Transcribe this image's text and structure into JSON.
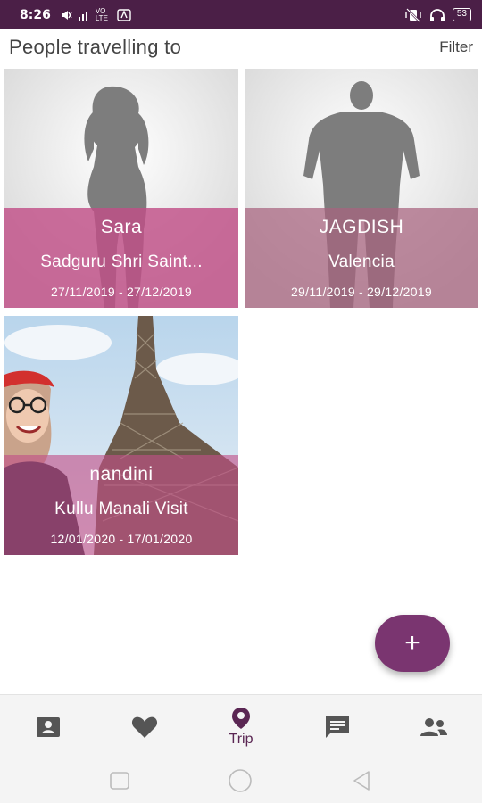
{
  "status_bar": {
    "time": "8:26",
    "network_label": "VO LTE",
    "battery": "53"
  },
  "header": {
    "title": "People travelling to",
    "filter_label": "Filter"
  },
  "cards": [
    {
      "name": "Sara",
      "place": "Sadguru Shri Saint...",
      "start_date": "27/11/2019",
      "end_date": "27/12/2019",
      "photo_icon": "female-silhouette"
    },
    {
      "name": "JAGDISH",
      "place": "Valencia",
      "start_date": "29/11/2019",
      "end_date": "29/12/2019",
      "photo_icon": "male-silhouette"
    },
    {
      "name": "nandini",
      "place": "Kullu Manali Visit",
      "start_date": "12/01/2020",
      "end_date": "17/01/2020",
      "photo_icon": "eiffel-tower-photo"
    }
  ],
  "date_separator": "-",
  "fab": {
    "label": "+"
  },
  "bottom_nav": {
    "items": [
      {
        "icon": "contact-card-icon",
        "label": ""
      },
      {
        "icon": "heart-icon",
        "label": ""
      },
      {
        "icon": "location-pin-icon",
        "label": "Trip"
      },
      {
        "icon": "chat-icon",
        "label": ""
      },
      {
        "icon": "people-icon",
        "label": ""
      }
    ]
  },
  "colors": {
    "status_bar": "#4b1f47",
    "accent": "#7a3570",
    "card_overlay_pink": "#c14f87",
    "card_overlay_muted": "#a8627e"
  }
}
